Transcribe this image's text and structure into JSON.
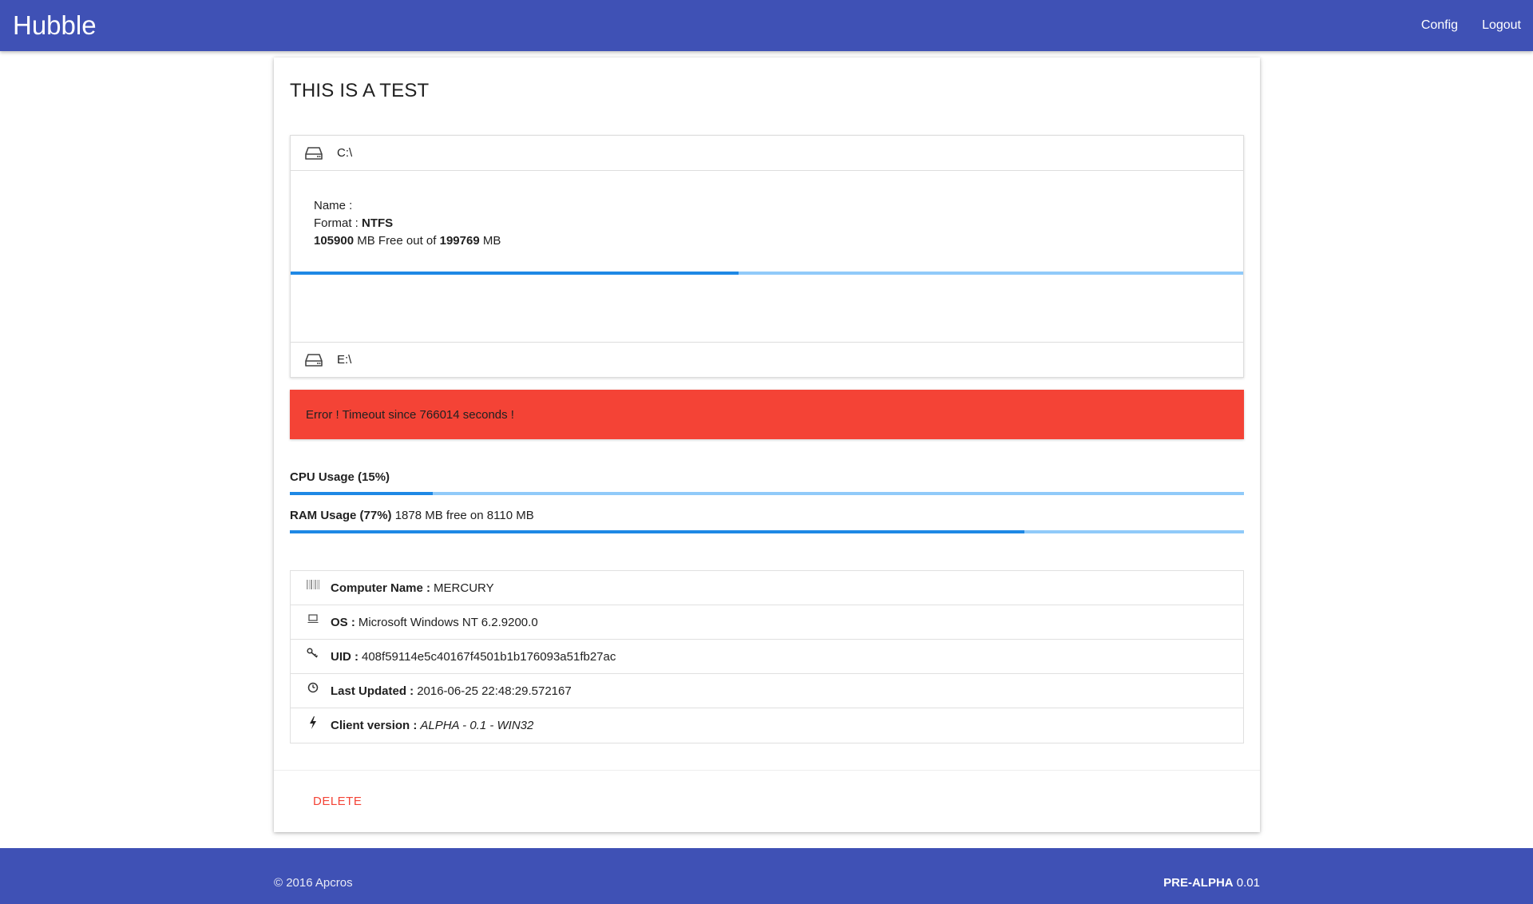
{
  "navbar": {
    "brand": "Hubble",
    "links": [
      "Config",
      "Logout"
    ]
  },
  "card": {
    "title": "THIS IS A TEST",
    "drives": [
      {
        "letter": "C:\\",
        "icon": "hard-drive-icon",
        "name_label": "Name :",
        "name_value": "",
        "format_label": "Format :",
        "format_value": "NTFS",
        "free_mb": "105900",
        "free_text": "MB Free out of",
        "total_mb": "199769",
        "unit": "MB",
        "used_fraction": 0.47
      },
      {
        "letter": "E:\\",
        "icon": "hard-drive-icon"
      }
    ],
    "error": "Error ! Timeout since 766014 seconds !",
    "cpu": {
      "label": "CPU Usage (15%)",
      "fraction": 0.15
    },
    "ram": {
      "label": "RAM Usage (77%)",
      "detail": "1878 MB free on 8110 MB",
      "fraction": 0.77
    },
    "info": [
      {
        "icon": "barcode-icon",
        "label": "Computer Name :",
        "value": "MERCURY"
      },
      {
        "icon": "laptop-icon",
        "label": "OS :",
        "value": "Microsoft Windows NT 6.2.9200.0"
      },
      {
        "icon": "key-icon",
        "label": "UID :",
        "value": "408f59114e5c40167f4501b1b176093a51fb27ac"
      },
      {
        "icon": "clock-icon",
        "label": "Last Updated :",
        "value": "2016-06-25 22:48:29.572167"
      },
      {
        "icon": "bolt-icon",
        "label": "Client version :",
        "value": "ALPHA - 0.1 - WIN32"
      }
    ],
    "delete_label": "DELETE"
  },
  "footer": {
    "copyright": "© 2016 Apcros",
    "version_label": "PRE-ALPHA",
    "version_number": "0.01"
  },
  "colors": {
    "primary": "#3f51b5",
    "error": "#f44336",
    "progress_fill": "#1e88e5",
    "progress_track": "#90caf9"
  }
}
